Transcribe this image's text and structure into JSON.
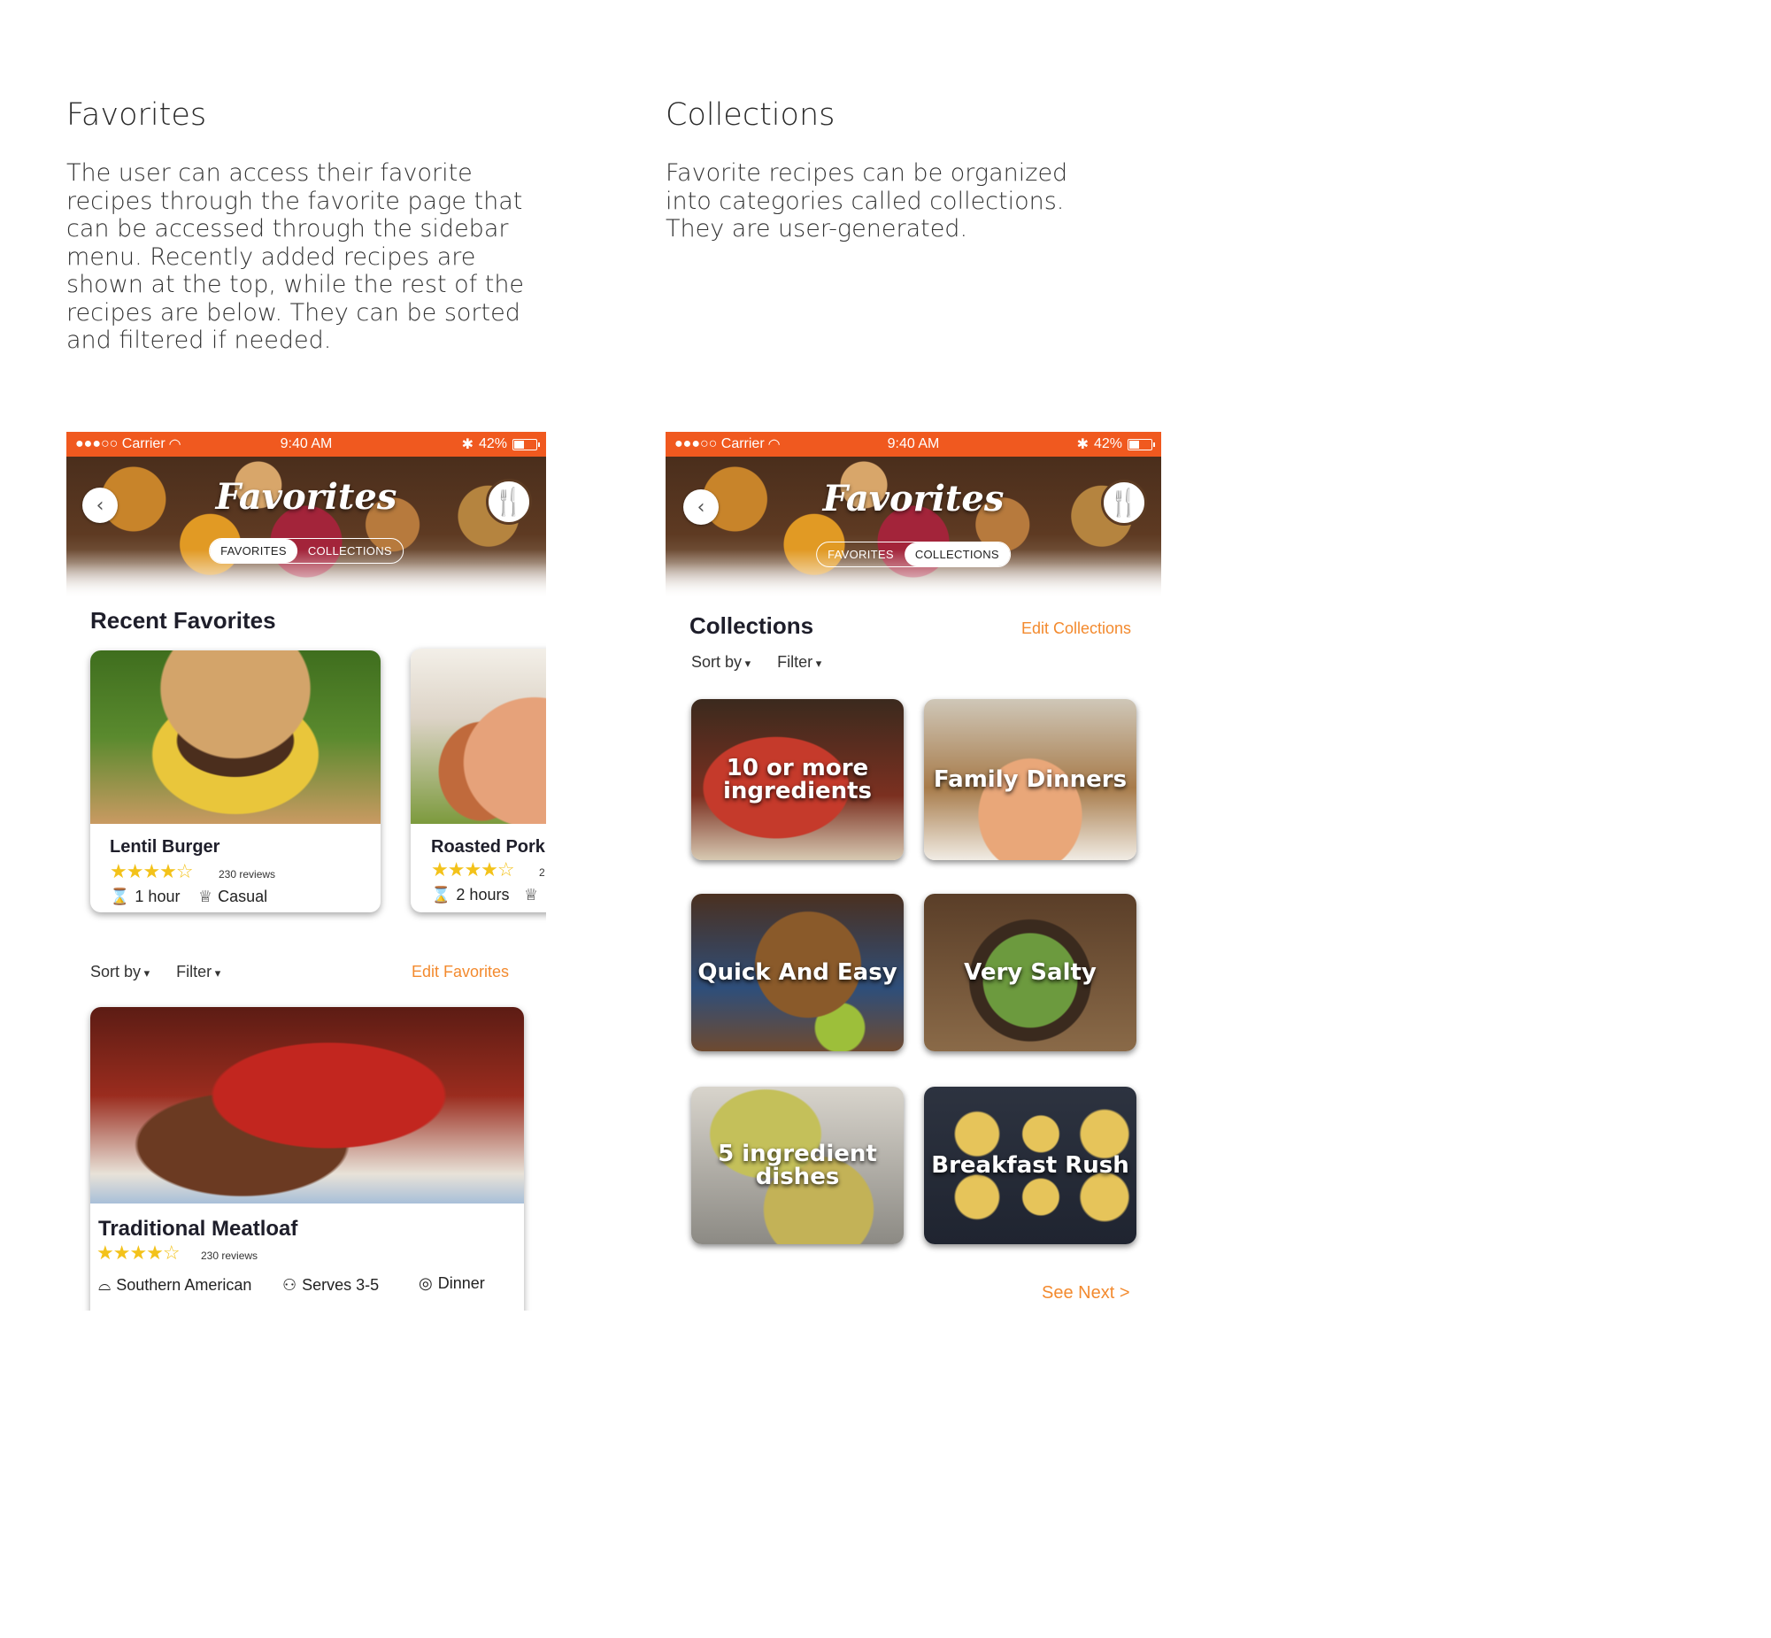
{
  "sections": {
    "favorites": {
      "title": "Favorites",
      "description": "The user can access their favorite recipes through the favorite page that can be accessed through the sidebar menu. Recently added recipes are shown at the top, while the rest of the recipes are below. They can be sorted and filtered if needed."
    },
    "collections": {
      "title": "Collections",
      "description": "Favorite recipes can be organized into categories called collections. They are user-generated."
    }
  },
  "status_bar": {
    "carrier": "●●●○○ Carrier",
    "time": "9:40 AM",
    "battery": "42%"
  },
  "header": {
    "title": "Favorites",
    "tabs": [
      "FAVORITES",
      "COLLECTIONS"
    ]
  },
  "favorites_screen": {
    "recent_heading": "Recent Favorites",
    "recent_cards": [
      {
        "name": "Lentil Burger",
        "stars": "★★★★☆",
        "reviews": "230 reviews",
        "time": "1 hour",
        "type": "Casual"
      },
      {
        "name": "Roasted Pork",
        "stars": "★★★★☆",
        "reviews": "2",
        "time": "2 hours",
        "type": ""
      }
    ],
    "sort_label": "Sort by",
    "filter_label": "Filter",
    "edit_label": "Edit Favorites",
    "main_card": {
      "name": "Traditional Meatloaf",
      "stars": "★★★★☆",
      "reviews": "230 reviews",
      "cuisine": "Southern American",
      "serves": "Serves 3-5",
      "meal": "Dinner"
    }
  },
  "collections_screen": {
    "heading": "Collections",
    "edit_label": "Edit Collections",
    "sort_label": "Sort by",
    "filter_label": "Filter",
    "tiles": [
      {
        "label": "10 or more ingredients"
      },
      {
        "label": "Family Dinners"
      },
      {
        "label": "Quick And Easy"
      },
      {
        "label": "Very Salty"
      },
      {
        "label": "5 ingredient dishes"
      },
      {
        "label": "Breakfast Rush"
      }
    ],
    "see_next": "See Next >"
  },
  "colors": {
    "accent": "#f0591f",
    "link": "#f38a2e",
    "star": "#f3c21a"
  }
}
